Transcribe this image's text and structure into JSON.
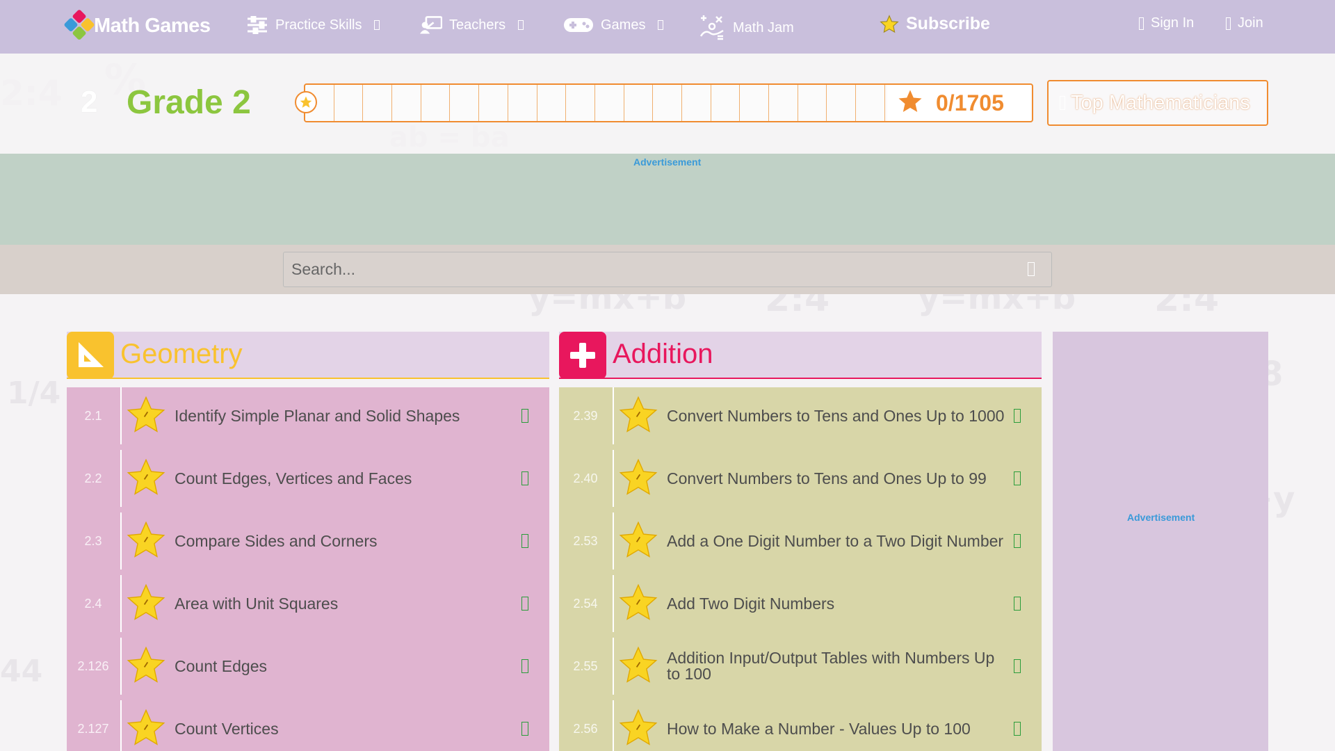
{
  "nav": {
    "logo_text": "Math Games",
    "items": [
      {
        "label": "Practice Skills",
        "icon": "sliders-icon"
      },
      {
        "label": "Teachers",
        "icon": "teacher-board-icon"
      },
      {
        "label": "Games",
        "icon": "gamepad-icon"
      },
      {
        "label": "Math Jam",
        "icon": "math-jam-icon"
      }
    ],
    "subscribe": "Subscribe",
    "sign_in": "Sign In",
    "join": "Join"
  },
  "grade": {
    "number": "2",
    "title": "Grade 2",
    "progress_value": 0,
    "progress_total": 1705,
    "progress_text": "0/1705",
    "top_mathematicians": "Top Mathematicians"
  },
  "ads": {
    "banner_label": "Advertisement",
    "side_label": "Advertisement"
  },
  "search": {
    "placeholder": "Search..."
  },
  "colors": {
    "nav_bg": "#c9bfdc",
    "grade_green": "#8cc63f",
    "progress_orange": "#f08c30",
    "geometry_yellow": "#f9c22e",
    "addition_pink": "#e8175d",
    "geometry_rows_bg": "#e0b4d0",
    "addition_rows_bg": "#d8d6a8"
  },
  "panels": [
    {
      "title": "Geometry",
      "icon": "set-square-icon",
      "skills": [
        {
          "num": "2.1",
          "label": "Identify Simple Planar and Solid Shapes"
        },
        {
          "num": "2.2",
          "label": "Count Edges, Vertices and Faces"
        },
        {
          "num": "2.3",
          "label": "Compare Sides and Corners"
        },
        {
          "num": "2.4",
          "label": "Area with Unit Squares"
        },
        {
          "num": "2.126",
          "label": "Count Edges"
        },
        {
          "num": "2.127",
          "label": "Count Vertices"
        }
      ]
    },
    {
      "title": "Addition",
      "icon": "plus-icon",
      "skills": [
        {
          "num": "2.39",
          "label": "Convert Numbers to Tens and Ones Up to 1000"
        },
        {
          "num": "2.40",
          "label": "Convert Numbers to Tens and Ones Up to 99"
        },
        {
          "num": "2.53",
          "label": "Add a One Digit Number to a Two Digit Number"
        },
        {
          "num": "2.54",
          "label": "Add Two Digit Numbers"
        },
        {
          "num": "2.55",
          "label": "Addition Input/Output Tables with Numbers Up to 100"
        },
        {
          "num": "2.56",
          "label": "How to Make a Number - Values Up to 100"
        }
      ]
    }
  ]
}
